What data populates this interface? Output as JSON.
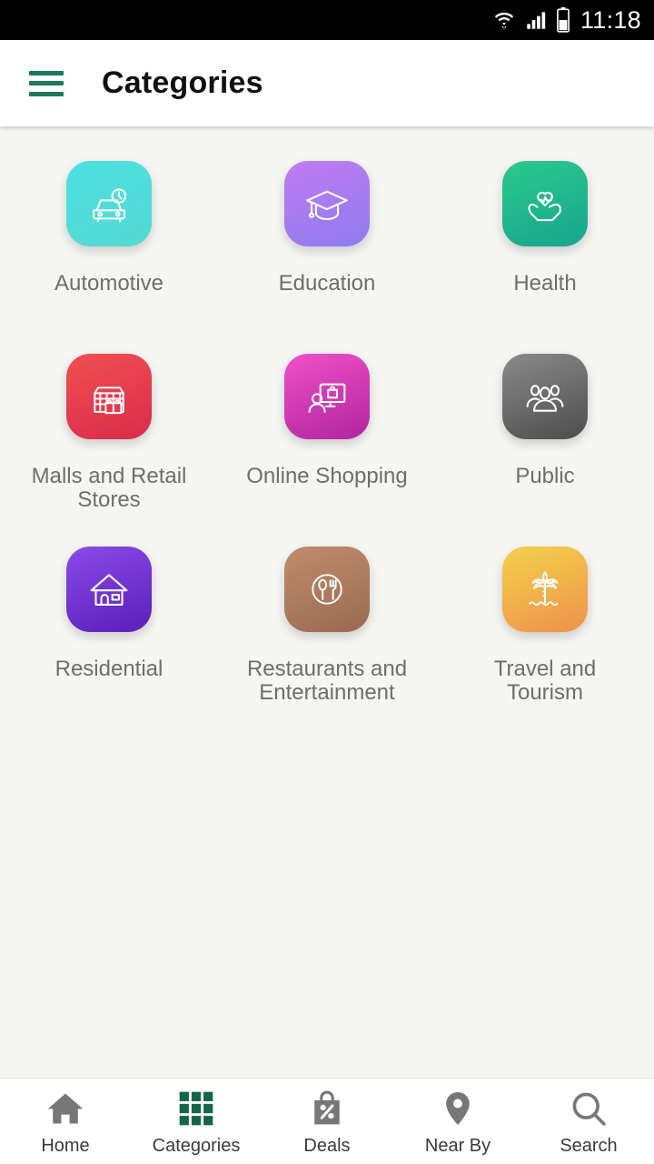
{
  "statusbar": {
    "time": "11:18",
    "icons": [
      "wifi-icon",
      "signal-icon",
      "battery-icon"
    ]
  },
  "appbar": {
    "menu_icon": "hamburger-menu-icon",
    "title": "Categories",
    "menu_color": "#1C7A5B"
  },
  "colors": {
    "page_background": "#F5F5F2",
    "surface": "#FFFFFF",
    "label_text": "#6E6E6E",
    "nav_inactive": "#777777",
    "nav_active": "#156648",
    "accent_green": "#1C7A5B"
  },
  "categories": [
    {
      "label": "Automotive",
      "icon": "car-icon",
      "gradient_from": "#4CE0E0",
      "gradient_to": "#52D9D2"
    },
    {
      "label": "Education",
      "icon": "graduation-cap-icon",
      "gradient_from": "#C07BF0",
      "gradient_to": "#8E7BF0"
    },
    {
      "label": "Health",
      "icon": "hands-heart-icon",
      "gradient_from": "#2BC98D",
      "gradient_to": "#17A58C"
    },
    {
      "label": "Malls and Retail Stores",
      "icon": "mall-shopping-bags-icon",
      "gradient_from": "#F05050",
      "gradient_to": "#D92B4B"
    },
    {
      "label": "Online Shopping",
      "icon": "online-shopping-monitor-icon",
      "gradient_from": "#F050C8",
      "gradient_to": "#B0259E"
    },
    {
      "label": "Public",
      "icon": "people-group-icon",
      "gradient_from": "#8A8A8A",
      "gradient_to": "#4D4D4D"
    },
    {
      "label": "Residential",
      "icon": "house-icon",
      "gradient_from": "#8A4BE8",
      "gradient_to": "#5A1FB8"
    },
    {
      "label": "Restaurants and Entertainment",
      "icon": "spoon-fork-icon",
      "gradient_from": "#C08C6A",
      "gradient_to": "#9A6A52"
    },
    {
      "label": "Travel and Tourism",
      "icon": "palm-tree-icon",
      "gradient_from": "#F2D24B",
      "gradient_to": "#F0914B"
    }
  ],
  "bottomnav": {
    "items": [
      {
        "label": "Home",
        "icon": "home-icon",
        "active": false
      },
      {
        "label": "Categories",
        "icon": "grid-icon",
        "active": true
      },
      {
        "label": "Deals",
        "icon": "deal-bag-icon",
        "active": false
      },
      {
        "label": "Near By",
        "icon": "map-pin-icon",
        "active": false
      },
      {
        "label": "Search",
        "icon": "search-icon",
        "active": false
      }
    ]
  }
}
